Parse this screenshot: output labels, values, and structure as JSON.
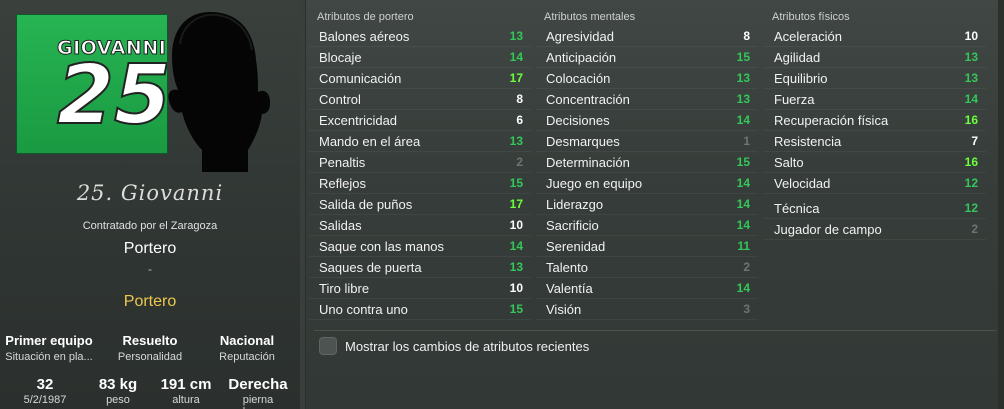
{
  "player": {
    "kit_name": "GIOVANNI",
    "kit_number": "25",
    "signature": "25. Giovanni",
    "contracted": "Contratado por el Zaragoza",
    "position": "Portero",
    "dash": "-",
    "position_highlight": "Portero",
    "info_top": [
      {
        "value": "Primer equipo",
        "label": "Situación en pla..."
      },
      {
        "value": "Resuelto",
        "label": "Personalidad"
      },
      {
        "value": "Nacional",
        "label": "Reputación"
      }
    ],
    "info_bottom": [
      {
        "value": "32",
        "label": "5/2/1987"
      },
      {
        "value": "83 kg",
        "label": "peso"
      },
      {
        "value": "191 cm",
        "label": "altura"
      },
      {
        "value": "Derecha",
        "label": "pierna buena"
      }
    ]
  },
  "colors": {
    "green": "#34c759",
    "bright_green": "#6cff3a",
    "grey": "#6f7472",
    "gold": "#ecc94b",
    "kit_green": "#1f9a46"
  },
  "attributes": {
    "goalkeeping": {
      "header": "Atributos de portero",
      "items": [
        {
          "name": "Balones aéreos",
          "value": "13",
          "tone": "green"
        },
        {
          "name": "Blocaje",
          "value": "14",
          "tone": "green"
        },
        {
          "name": "Comunicación",
          "value": "17",
          "tone": "bright"
        },
        {
          "name": "Control",
          "value": "8",
          "tone": "white"
        },
        {
          "name": "Excentricidad",
          "value": "6",
          "tone": "white"
        },
        {
          "name": "Mando en el área",
          "value": "13",
          "tone": "green"
        },
        {
          "name": "Penaltis",
          "value": "2",
          "tone": "grey"
        },
        {
          "name": "Reflejos",
          "value": "15",
          "tone": "green"
        },
        {
          "name": "Salida de puños",
          "value": "17",
          "tone": "bright"
        },
        {
          "name": "Salidas",
          "value": "10",
          "tone": "white"
        },
        {
          "name": "Saque con las manos",
          "value": "14",
          "tone": "green"
        },
        {
          "name": "Saques de puerta",
          "value": "13",
          "tone": "green"
        },
        {
          "name": "Tiro libre",
          "value": "10",
          "tone": "white"
        },
        {
          "name": "Uno contra uno",
          "value": "15",
          "tone": "green"
        }
      ]
    },
    "mental": {
      "header": "Atributos mentales",
      "items": [
        {
          "name": "Agresividad",
          "value": "8",
          "tone": "white"
        },
        {
          "name": "Anticipación",
          "value": "15",
          "tone": "green"
        },
        {
          "name": "Colocación",
          "value": "13",
          "tone": "green"
        },
        {
          "name": "Concentración",
          "value": "13",
          "tone": "green"
        },
        {
          "name": "Decisiones",
          "value": "14",
          "tone": "green"
        },
        {
          "name": "Desmarques",
          "value": "1",
          "tone": "grey"
        },
        {
          "name": "Determinación",
          "value": "15",
          "tone": "green"
        },
        {
          "name": "Juego en equipo",
          "value": "14",
          "tone": "green"
        },
        {
          "name": "Liderazgo",
          "value": "14",
          "tone": "green"
        },
        {
          "name": "Sacrificio",
          "value": "14",
          "tone": "green"
        },
        {
          "name": "Serenidad",
          "value": "11",
          "tone": "green"
        },
        {
          "name": "Talento",
          "value": "2",
          "tone": "grey"
        },
        {
          "name": "Valentía",
          "value": "14",
          "tone": "green"
        },
        {
          "name": "Visión",
          "value": "3",
          "tone": "grey"
        }
      ]
    },
    "physical": {
      "header": "Atributos físicos",
      "items": [
        {
          "name": "Aceleración",
          "value": "10",
          "tone": "white"
        },
        {
          "name": "Agilidad",
          "value": "13",
          "tone": "green"
        },
        {
          "name": "Equilibrio",
          "value": "13",
          "tone": "green"
        },
        {
          "name": "Fuerza",
          "value": "14",
          "tone": "green"
        },
        {
          "name": "Recuperación física",
          "value": "16",
          "tone": "bright"
        },
        {
          "name": "Resistencia",
          "value": "7",
          "tone": "white"
        },
        {
          "name": "Salto",
          "value": "16",
          "tone": "bright"
        },
        {
          "name": "Velocidad",
          "value": "12",
          "tone": "green"
        }
      ],
      "extra": [
        {
          "name": "Técnica",
          "value": "12",
          "tone": "green"
        },
        {
          "name": "Jugador de campo",
          "value": "2",
          "tone": "grey"
        }
      ]
    }
  },
  "options": {
    "show_recent_changes_label": "Mostrar los cambios de atributos recientes"
  }
}
